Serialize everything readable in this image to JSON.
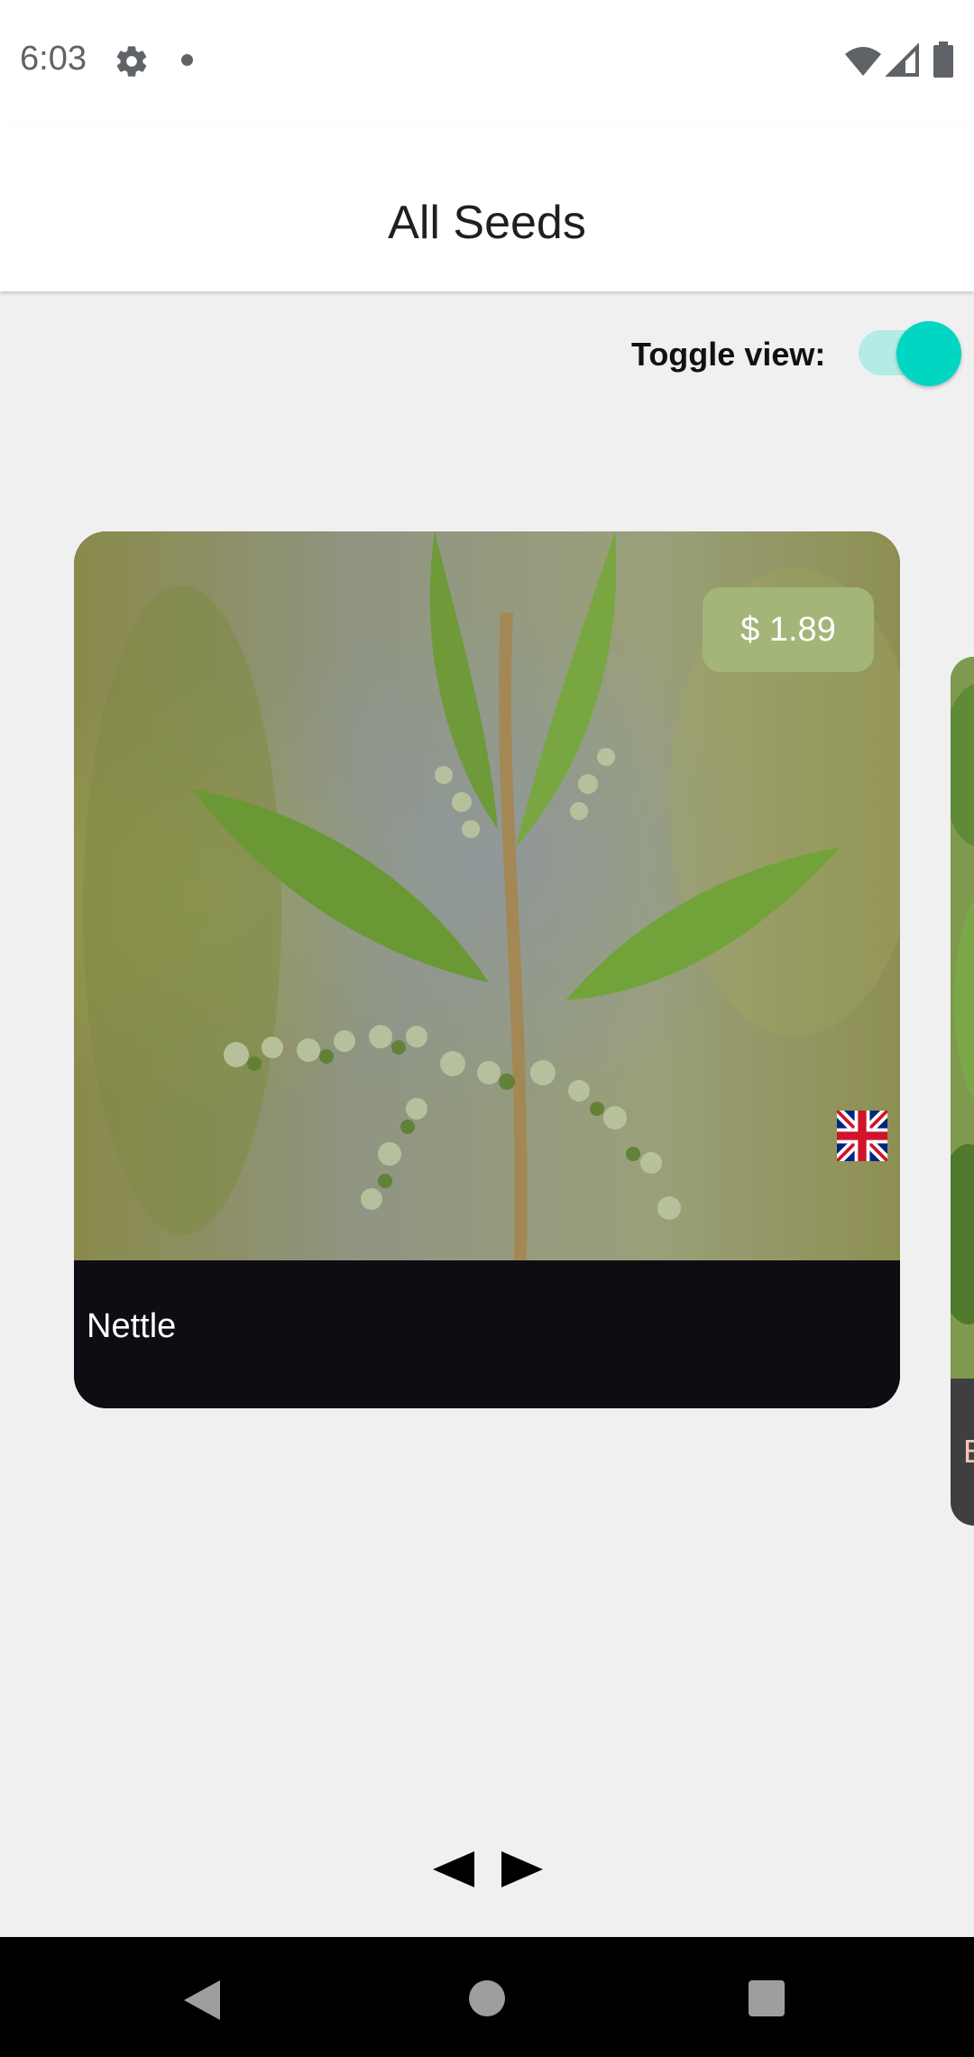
{
  "status_bar": {
    "time": "6:03",
    "icons": [
      "gear-icon",
      "notification-dot-icon",
      "wifi-icon",
      "signal-icon",
      "battery-icon"
    ]
  },
  "header": {
    "title": "All Seeds"
  },
  "toggle": {
    "label": "Toggle view:",
    "state": "on",
    "track_color": "#b3ece5",
    "thumb_color": "#00d6c2"
  },
  "carousel": {
    "current_card": {
      "name": "Nettle",
      "price": "$ 1.89",
      "price_badge_color": "#a4b578",
      "flag_icon": "uk-flag-icon"
    },
    "next_card_peek": {
      "visible_letter": "E"
    }
  },
  "pager": {
    "prev_icon": "triangle-left-icon",
    "next_icon": "triangle-right-icon"
  },
  "nav_bar": {
    "icons": [
      "back-icon",
      "home-icon",
      "recents-icon"
    ]
  }
}
